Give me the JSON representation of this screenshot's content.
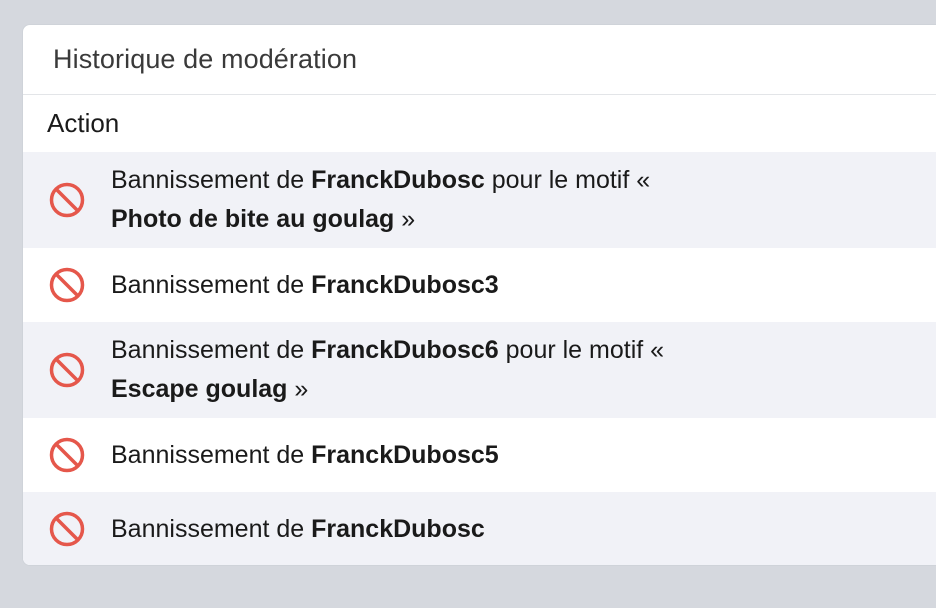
{
  "panel": {
    "title": "Historique de modération",
    "column_header": "Action"
  },
  "icons": {
    "ban": "ban-icon",
    "ban_color": "#e5574b"
  },
  "rows": [
    {
      "prefix": "Bannissement de ",
      "user": "FranckDubosc",
      "motif_prefix": " pour le motif «",
      "motif": "Photo de bite au goulag",
      "motif_suffix": " »"
    },
    {
      "prefix": "Bannissement de ",
      "user": "FranckDubosc3"
    },
    {
      "prefix": "Bannissement de ",
      "user": "FranckDubosc6",
      "motif_prefix": " pour le motif «",
      "motif": "Escape goulag",
      "motif_suffix": " »"
    },
    {
      "prefix": "Bannissement de ",
      "user": "FranckDubosc5"
    },
    {
      "prefix": "Bannissement de ",
      "user": "FranckDubosc"
    }
  ]
}
